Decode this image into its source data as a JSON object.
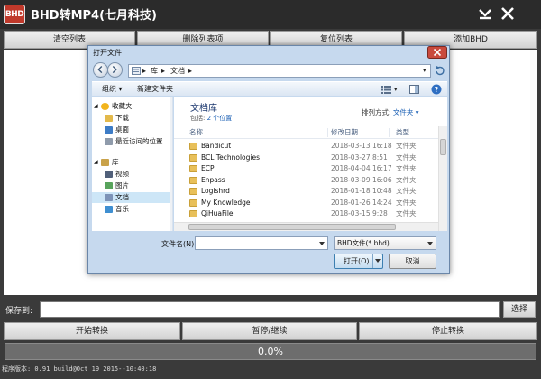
{
  "app": {
    "logo_text": "BHD",
    "title": "BHD转MP4(七月科技)"
  },
  "toolbar": {
    "clear": "清空列表",
    "delete": "删除列表项",
    "reset": "复位列表",
    "add": "添加BHD"
  },
  "save": {
    "label": "保存到:",
    "path": "",
    "browse": "选择"
  },
  "actions": {
    "start": "开始转换",
    "pause": "暂停/继续",
    "stop": "停止转换"
  },
  "progress": {
    "value": 0,
    "text": "0.0%"
  },
  "status": {
    "text": "程序版本: 0.91  build@Oct 19 2015--10:40:18"
  },
  "dialog": {
    "title": "打开文件",
    "address": [
      "库",
      "文档"
    ],
    "commands": {
      "organize": "组织 ▾",
      "new_folder": "新建文件夹"
    },
    "nav": [
      {
        "label": "收藏夹",
        "icon": "star-icon",
        "type": "group"
      },
      {
        "label": "下载",
        "icon": "download-folder-icon",
        "type": "item"
      },
      {
        "label": "桌面",
        "icon": "desktop-icon",
        "type": "item"
      },
      {
        "label": "最近访问的位置",
        "icon": "recent-places-icon",
        "type": "item"
      },
      {
        "label": "库",
        "icon": "library-icon",
        "type": "group"
      },
      {
        "label": "视频",
        "icon": "video-icon",
        "type": "item"
      },
      {
        "label": "图片",
        "icon": "picture-icon",
        "type": "item"
      },
      {
        "label": "文档",
        "icon": "document-icon",
        "type": "item",
        "selected": true
      },
      {
        "label": "音乐",
        "icon": "music-icon",
        "type": "item"
      }
    ],
    "library": {
      "title": "文档库",
      "includes_prefix": "包括:",
      "includes_link": "2 个位置",
      "arrange_label": "排列方式:",
      "arrange_value": "文件夹 ▾"
    },
    "columns": {
      "name": "名称",
      "modified": "修改日期",
      "type": "类型"
    },
    "files": [
      {
        "name": "Bandicut",
        "date": "2018-03-13 16:18",
        "type": "文件夹"
      },
      {
        "name": "BCL Technologies",
        "date": "2018-03-27 8:51",
        "type": "文件夹"
      },
      {
        "name": "ECP",
        "date": "2018-04-04 16:17",
        "type": "文件夹"
      },
      {
        "name": "Enpass",
        "date": "2018-03-09 16:06",
        "type": "文件夹"
      },
      {
        "name": "Logishrd",
        "date": "2018-01-18 10:48",
        "type": "文件夹"
      },
      {
        "name": "My Knowledge",
        "date": "2018-01-26 14:24",
        "type": "文件夹"
      },
      {
        "name": "QiHuaFile",
        "date": "2018-03-15 9:28",
        "type": "文件夹"
      }
    ],
    "filename_label": "文件名(N):",
    "filename_value": "",
    "filetype": "BHD文件(*.bhd)",
    "open": "打开(O)",
    "cancel": "取消"
  },
  "colors": {
    "titlebar": "#2b2b2b",
    "accent": "#c0392b",
    "dialog_frame": "#c6d9ee"
  }
}
